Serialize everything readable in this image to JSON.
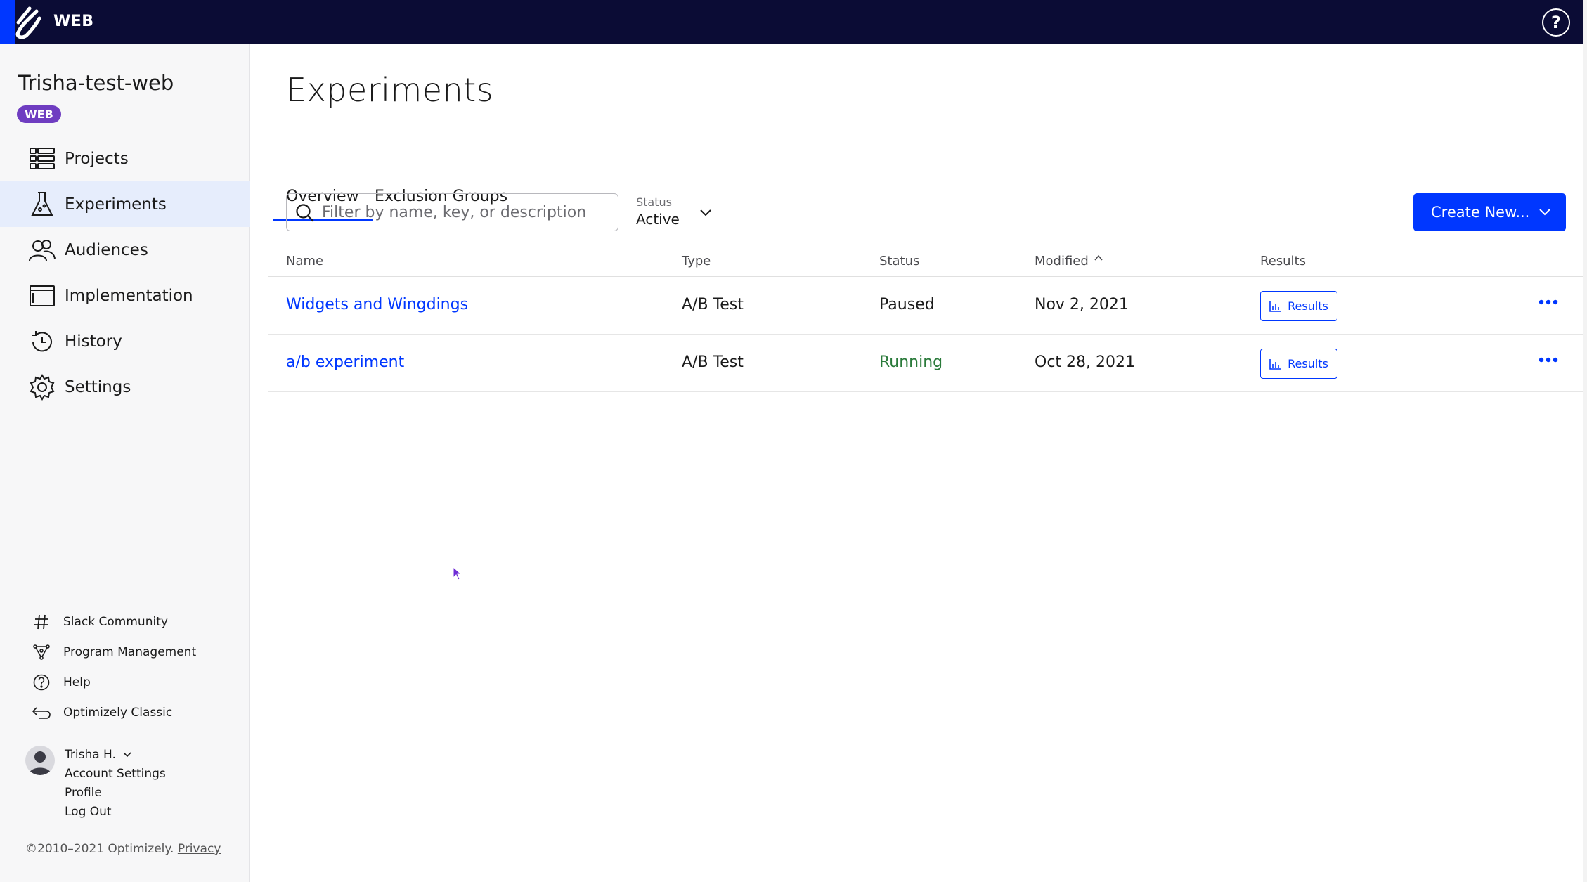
{
  "topbar": {
    "product": "WEB",
    "help_glyph": "?"
  },
  "sidebar": {
    "project_name": "Trisha-test-web",
    "badge": "WEB",
    "nav": [
      {
        "label": "Projects",
        "icon": "list-icon"
      },
      {
        "label": "Experiments",
        "icon": "beaker-icon",
        "active": true
      },
      {
        "label": "Audiences",
        "icon": "people-icon"
      },
      {
        "label": "Implementation",
        "icon": "window-icon"
      },
      {
        "label": "History",
        "icon": "history-icon"
      },
      {
        "label": "Settings",
        "icon": "gear-icon"
      }
    ],
    "footer_links": [
      {
        "label": "Slack Community",
        "icon": "hash-icon"
      },
      {
        "label": "Program Management",
        "icon": "network-icon"
      },
      {
        "label": "Help",
        "icon": "question-icon"
      },
      {
        "label": "Optimizely Classic",
        "icon": "return-icon"
      }
    ],
    "user": {
      "name": "Trisha H.",
      "account_settings": "Account Settings",
      "profile": "Profile",
      "logout": "Log Out"
    },
    "copyright": "©2010–2021 Optimizely.",
    "privacy": "Privacy"
  },
  "main": {
    "title": "Experiments",
    "tabs": [
      {
        "label": "Overview",
        "active": true
      },
      {
        "label": "Exclusion Groups"
      }
    ],
    "filter": {
      "placeholder": "Filter by name, key, or description"
    },
    "status_filter": {
      "label": "Status",
      "value": "Active"
    },
    "create_button": "Create New...",
    "table": {
      "headers": {
        "name": "Name",
        "type": "Type",
        "status": "Status",
        "modified": "Modified",
        "results": "Results"
      },
      "rows": [
        {
          "name": "Widgets and Wingdings",
          "type": "A/B Test",
          "status": "Paused",
          "modified": "Nov 2, 2021",
          "results": "Results"
        },
        {
          "name": "a/b experiment",
          "type": "A/B Test",
          "status": "Running",
          "modified": "Oct 28, 2021",
          "results": "Results"
        }
      ]
    }
  },
  "colors": {
    "accent": "#0037ff",
    "topbar": "#0b0c35",
    "badge": "#6f3dc1",
    "running": "#2a7a3a"
  }
}
